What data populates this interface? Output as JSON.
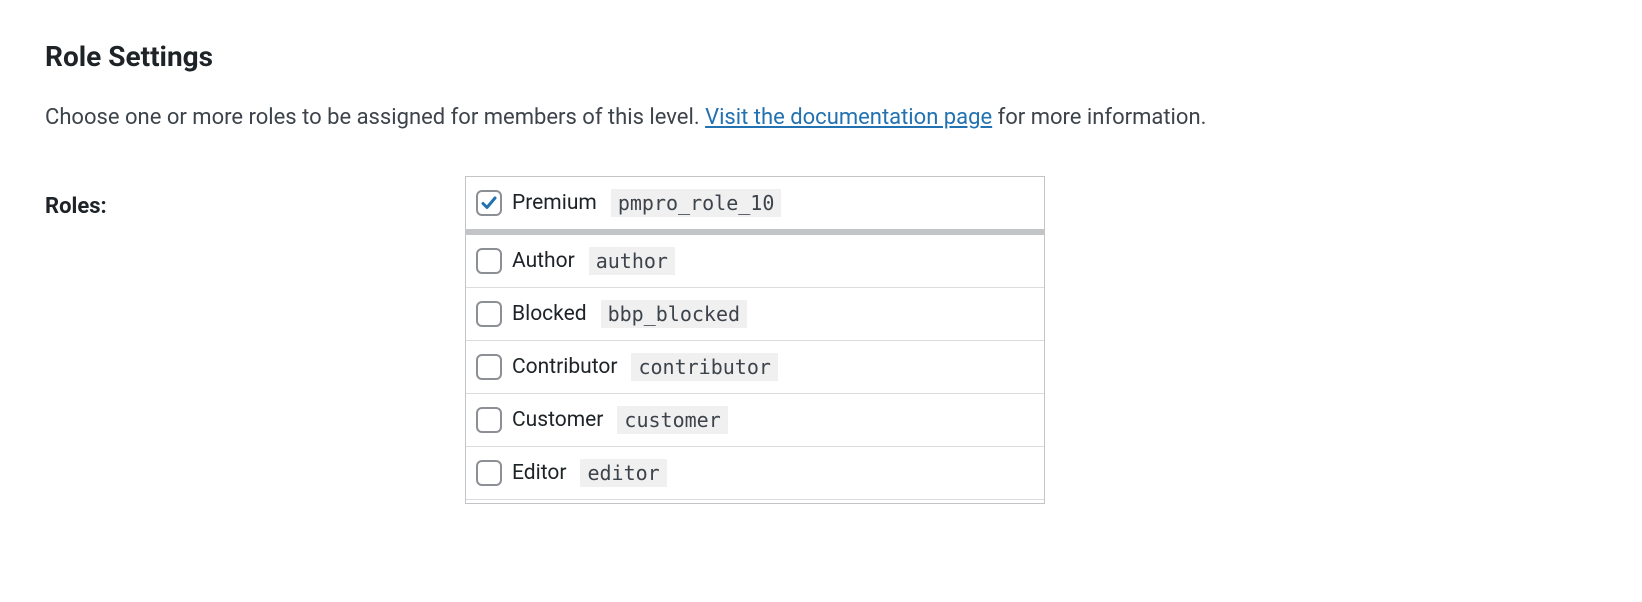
{
  "header": {
    "title": "Role Settings"
  },
  "description": {
    "text_before": "Choose one or more roles to be assigned for members of this level. ",
    "link_text": "Visit the documentation page",
    "text_after": " for more information."
  },
  "form": {
    "roles_label": "Roles:",
    "roles": [
      {
        "label": "Premium",
        "slug": "pmpro_role_10",
        "checked": true,
        "separator": true
      },
      {
        "label": "Author",
        "slug": "author",
        "checked": false,
        "separator": false
      },
      {
        "label": "Blocked",
        "slug": "bbp_blocked",
        "checked": false,
        "separator": false
      },
      {
        "label": "Contributor",
        "slug": "contributor",
        "checked": false,
        "separator": false
      },
      {
        "label": "Customer",
        "slug": "customer",
        "checked": false,
        "separator": false
      },
      {
        "label": "Editor",
        "slug": "editor",
        "checked": false,
        "separator": false
      }
    ]
  }
}
